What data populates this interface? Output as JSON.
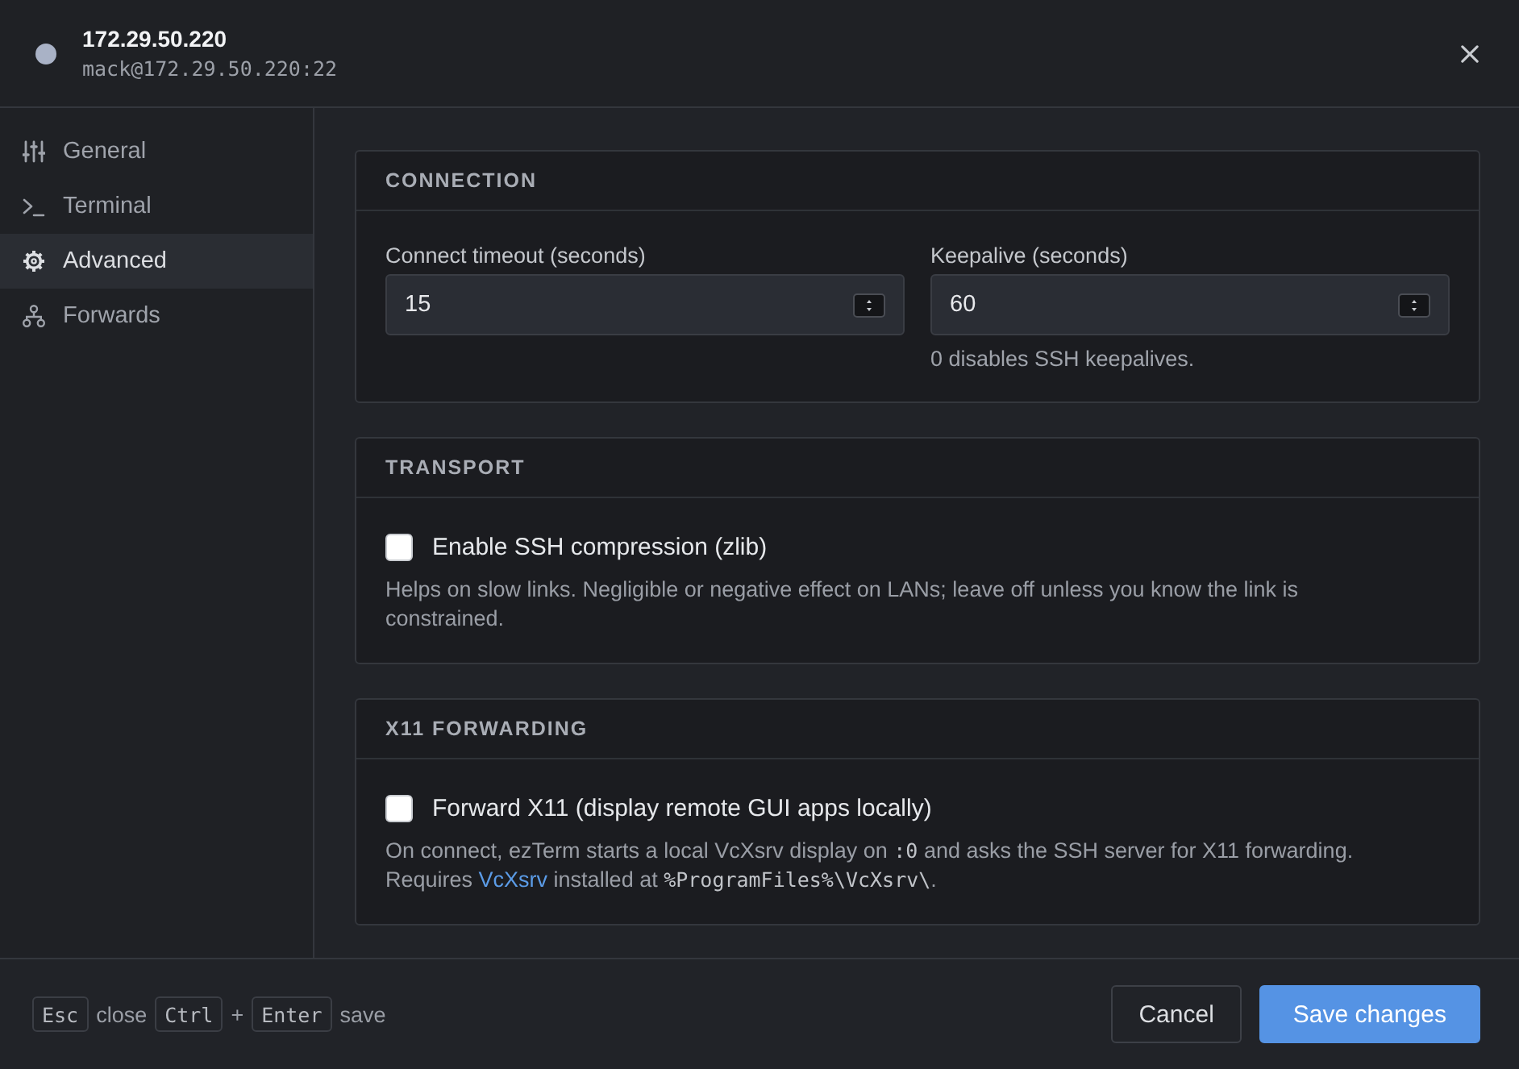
{
  "header": {
    "title": "172.29.50.220",
    "subtitle": "mack@172.29.50.220:22"
  },
  "sidebar": {
    "items": [
      {
        "label": "General",
        "selected": false
      },
      {
        "label": "Terminal",
        "selected": false
      },
      {
        "label": "Advanced",
        "selected": true
      },
      {
        "label": "Forwards",
        "selected": false
      }
    ]
  },
  "sections": [
    {
      "title": "CONNECTION",
      "kind": "fields",
      "fields": [
        {
          "label": "Connect timeout (seconds)",
          "value": "15"
        },
        {
          "label": "Keepalive (seconds)",
          "value": "60",
          "hint": "0 disables SSH keepalives."
        }
      ]
    },
    {
      "title": "TRANSPORT",
      "kind": "checkbox",
      "checkbox": {
        "label": "Enable SSH compression (zlib)",
        "checked": false
      },
      "help": [
        {
          "kind": "text",
          "text": "Helps on slow links. Negligible or negative effect on LANs; leave off unless you know the link is constrained."
        }
      ]
    },
    {
      "title": "X11 FORWARDING",
      "kind": "checkbox",
      "checkbox": {
        "label": "Forward X11 (display remote GUI apps locally)",
        "checked": false
      },
      "help": [
        {
          "kind": "text",
          "text": "On connect, ezTerm starts a local VcXsrv display on "
        },
        {
          "kind": "code",
          "text": ":0"
        },
        {
          "kind": "text",
          "text": " and asks the SSH server for X11 forwarding. Requires "
        },
        {
          "kind": "link",
          "text": "VcXsrv"
        },
        {
          "kind": "text",
          "text": " installed at "
        },
        {
          "kind": "code",
          "text": "%ProgramFiles%\\VcXsrv\\"
        },
        {
          "kind": "text",
          "text": "."
        }
      ]
    }
  ],
  "footer": {
    "shortcuts": [
      {
        "kind": "key",
        "text": "Esc"
      },
      {
        "kind": "text",
        "text": "close"
      },
      {
        "kind": "key",
        "text": "Ctrl"
      },
      {
        "kind": "text",
        "text": "+"
      },
      {
        "kind": "key",
        "text": "Enter"
      },
      {
        "kind": "text",
        "text": "save"
      }
    ],
    "buttons": [
      {
        "label": "Cancel",
        "kind": "secondary"
      },
      {
        "label": "Save changes",
        "kind": "primary"
      }
    ]
  }
}
